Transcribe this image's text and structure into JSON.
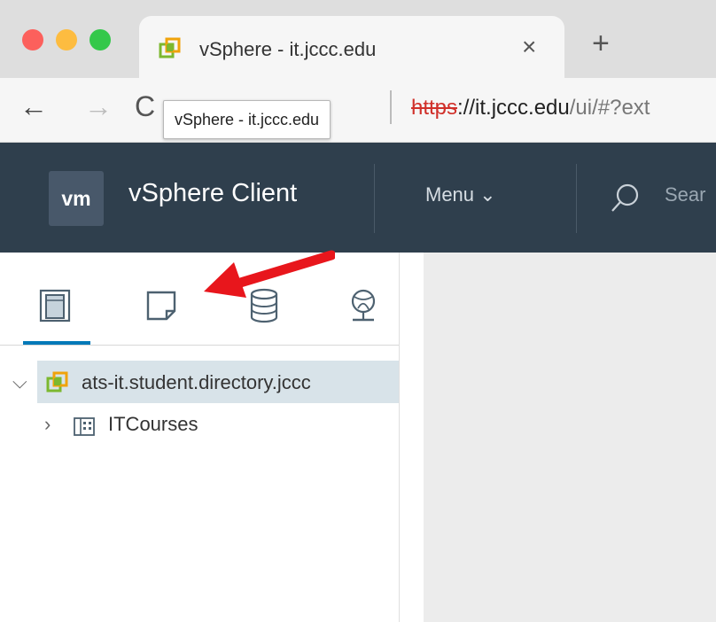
{
  "browser": {
    "tab": {
      "title": "vSphere - it.jccc.edu",
      "close_glyph": "×",
      "favicon": "vsphere-logo-icon"
    },
    "new_tab_glyph": "+",
    "nav": {
      "back_glyph": "←",
      "forward_glyph": "→",
      "reload_glyph": "C"
    },
    "address": {
      "scheme": "https",
      "host": "://it.jccc.edu",
      "path": "/ui/#?ext"
    },
    "tooltip": "vSphere - it.jccc.edu"
  },
  "header": {
    "logo_text": "vm",
    "app_title": "vSphere Client",
    "menu_label": "Menu ⌄",
    "search_placeholder": "Sear"
  },
  "sidebar": {
    "tabs": [
      {
        "name": "hosts-and-clusters",
        "icon": "hosts-clusters-icon",
        "selected": true
      },
      {
        "name": "vms-and-templates",
        "icon": "vms-templates-icon",
        "selected": false
      },
      {
        "name": "storage",
        "icon": "storage-icon",
        "selected": false
      },
      {
        "name": "networking",
        "icon": "networking-icon",
        "selected": false
      }
    ],
    "tree": [
      {
        "label": "ats-it.student.directory.jccc",
        "expanded": true,
        "selected": true,
        "icon": "vcenter-icon"
      },
      {
        "label": "ITCourses",
        "expanded": false,
        "selected": false,
        "icon": "datacenter-icon"
      }
    ]
  },
  "colors": {
    "header_bg": "#2f3f4d",
    "accent": "#0079b8",
    "annotation_arrow": "#e8161c",
    "selected_row": "#d8e3e9"
  }
}
